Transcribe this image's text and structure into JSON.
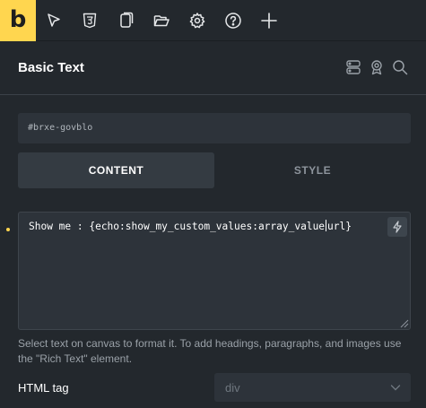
{
  "toolbar": {
    "logo_text": "b",
    "icons": [
      "cursor-icon",
      "css3-icon",
      "copy-icon",
      "folder-icon",
      "gear-icon",
      "help-icon",
      "plus-icon"
    ]
  },
  "panel": {
    "title": "Basic Text",
    "header_icons": [
      "structure-icon",
      "badge-icon",
      "search-icon"
    ]
  },
  "css_id": "#brxe-govblo",
  "tabs": [
    {
      "label": "CONTENT",
      "active": true
    },
    {
      "label": "STYLE",
      "active": false
    }
  ],
  "text_field": {
    "value_before_caret": "Show me : {echo:show_my_custom_values:array_value",
    "value_after_caret": "url}"
  },
  "help_text": "Select text on canvas to format it. To add headings, paragraphs, and images use the \"Rich Text\" element.",
  "html_tag": {
    "label": "HTML tag",
    "value": "div"
  },
  "colors": {
    "accent": "#ffd64f",
    "background": "#23282d",
    "field": "#2d333a"
  }
}
